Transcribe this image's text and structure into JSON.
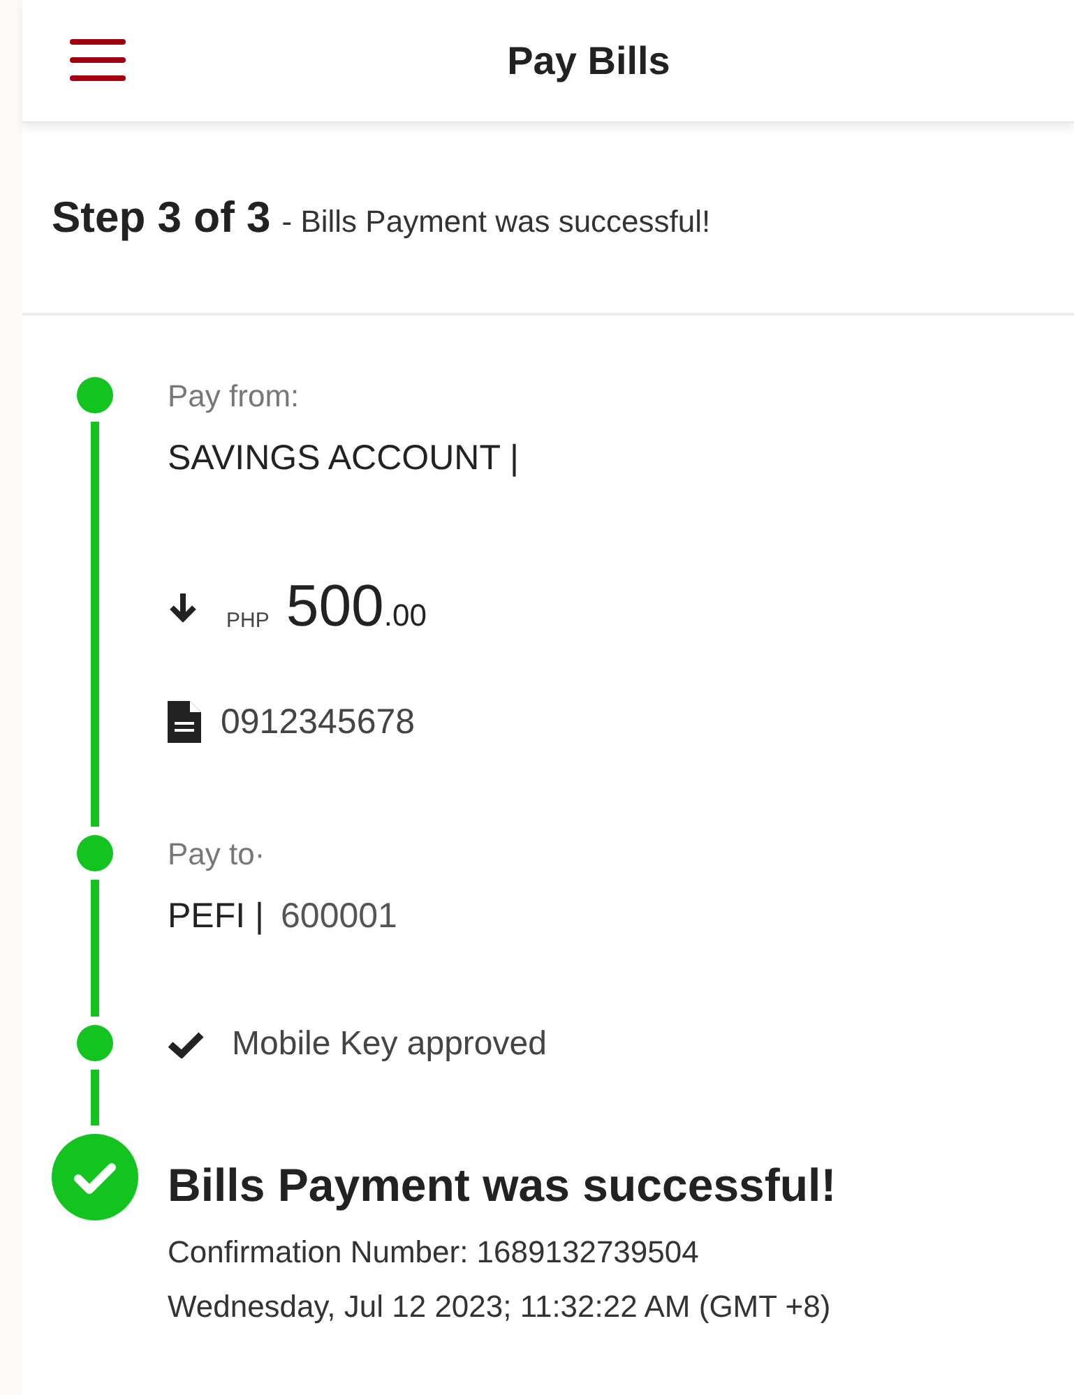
{
  "header": {
    "title": "Pay Bills"
  },
  "step": {
    "label": "Step 3 of 3",
    "message": "- Bills Payment was successful!"
  },
  "timeline": [
    {
      "kind": "pay_from",
      "label": "Pay from:",
      "account": "SAVINGS ACCOUNT |",
      "currency": "PHP",
      "amount": "500",
      "cents": ".00",
      "reference": "0912345678"
    },
    {
      "kind": "pay_to",
      "label": "Pay to·",
      "biller": "PEFI |",
      "biller_code": "600001"
    },
    {
      "kind": "approval",
      "text": "Mobile Key approved"
    },
    {
      "kind": "result",
      "title": "Bills Payment was successful!",
      "confirmation": "Confirmation Number: 1689132739504",
      "timestamp": "Wednesday, Jul 12 2023; 11:32:22 AM (GMT +8)"
    }
  ]
}
